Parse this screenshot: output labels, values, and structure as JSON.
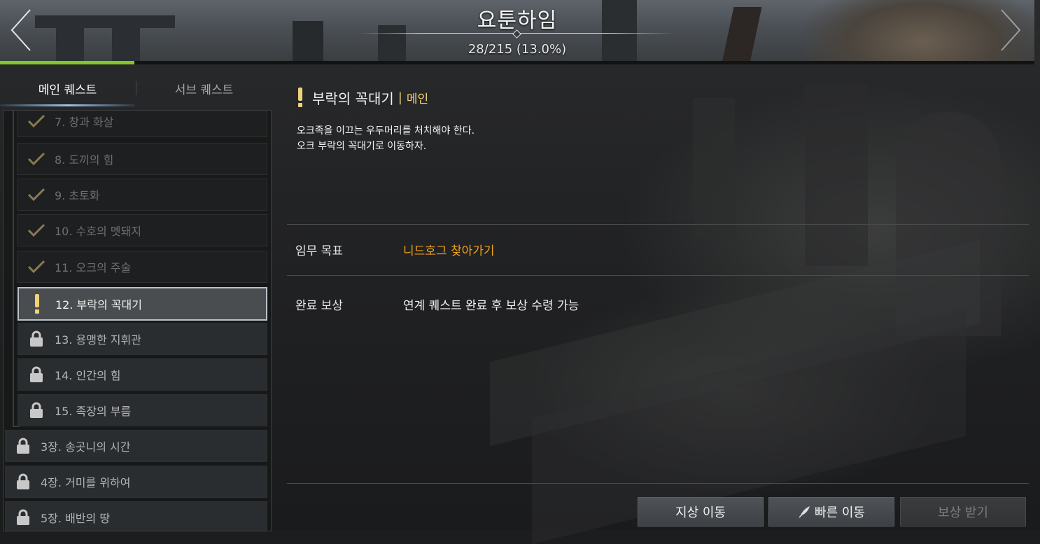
{
  "header": {
    "title": "요툰하임",
    "progress_text": "28/215 (13.0%)",
    "progress_fraction": 0.13,
    "prev_icon": "chevron-left-icon",
    "next_icon": "chevron-right-icon"
  },
  "tabs": [
    {
      "label": "메인 퀘스트",
      "active": true
    },
    {
      "label": "서브 퀘스트",
      "active": false
    }
  ],
  "quest_list": [
    {
      "label": "7. 창과 화살",
      "state": "done",
      "icon": "check-icon"
    },
    {
      "label": "8. 도끼의 힘",
      "state": "done",
      "icon": "check-icon"
    },
    {
      "label": "9. 초토화",
      "state": "done",
      "icon": "check-icon"
    },
    {
      "label": "10. 수호의 멧돼지",
      "state": "done",
      "icon": "check-icon"
    },
    {
      "label": "11. 오크의 주술",
      "state": "done",
      "icon": "check-icon"
    },
    {
      "label": "12. 부락의 꼭대기",
      "state": "active",
      "icon": "exclamation-icon"
    },
    {
      "label": "13. 용맹한 지휘관",
      "state": "locked",
      "icon": "lock-icon"
    },
    {
      "label": "14. 인간의 힘",
      "state": "locked",
      "icon": "lock-icon"
    },
    {
      "label": "15. 족장의 부름",
      "state": "locked",
      "icon": "lock-icon"
    }
  ],
  "chapters": [
    {
      "label": "3장. 송곳니의 시간",
      "state": "locked",
      "icon": "lock-icon"
    },
    {
      "label": "4장. 거미를 위하여",
      "state": "locked",
      "icon": "lock-icon"
    },
    {
      "label": "5장. 배반의 땅",
      "state": "locked",
      "icon": "lock-icon"
    }
  ],
  "detail": {
    "title": "부락의 꼭대기",
    "separator": "|",
    "type": "메인",
    "description_lines": [
      "오크족을 이끄는 우두머리를 처치해야 한다.",
      "오크 부락의 꼭대기로 이동하자."
    ],
    "objective_label": "임무 목표",
    "objective_value": "니드호그 찾아가기",
    "reward_label": "완료 보상",
    "reward_value": "연계 퀘스트 완료 후 보상 수령 가능"
  },
  "buttons": {
    "ground_move": "지상 이동",
    "fast_move": "빠른 이동",
    "fast_move_icon": "feather-icon",
    "claim_reward": "보상 받기"
  },
  "colors": {
    "progress": "#7ec82a",
    "objective": "#f0a020",
    "quest_type": "#f0d27a",
    "check": "#8a7a50"
  }
}
